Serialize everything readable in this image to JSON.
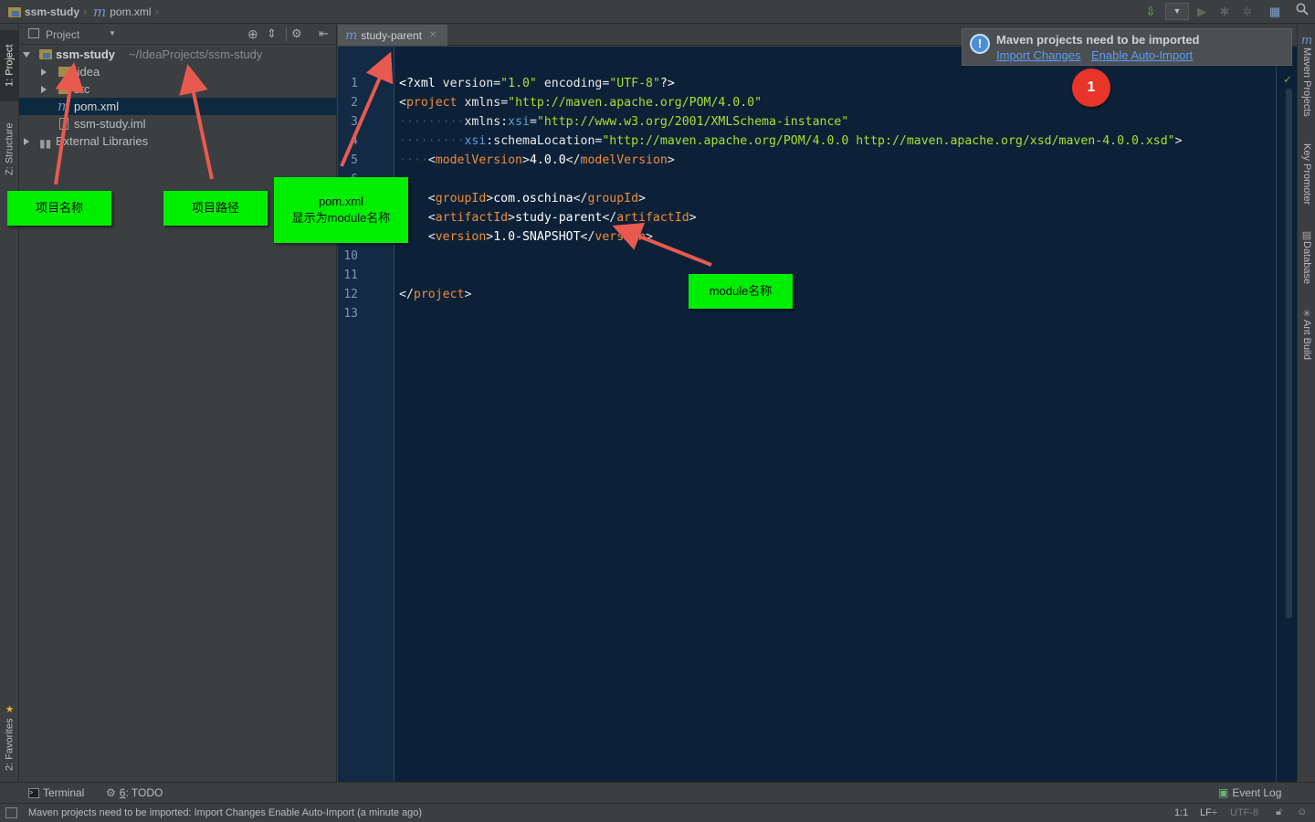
{
  "breadcrumb": {
    "project": "ssm-study",
    "file_icon": "m",
    "file": "pom.xml"
  },
  "left_strip": {
    "project_tab": "1: Project",
    "structure_tab": "Z: Structure",
    "favorites_tab": "2: Favorites"
  },
  "right_strip": {
    "maven_tab": "Maven Projects",
    "key_promoter_tab": "Key Promoter",
    "database_tab": "Database",
    "ant_tab": "Ant Build"
  },
  "project_panel": {
    "view_label": "Project",
    "tree": [
      {
        "name": "ssm-study",
        "path": "~/IdeaProjects/ssm-study"
      },
      {
        "name": ".idea"
      },
      {
        "name": "src"
      },
      {
        "name": "pom.xml"
      },
      {
        "name": "ssm-study.iml"
      },
      {
        "name": "External Libraries"
      }
    ]
  },
  "editor": {
    "tab_icon": "m",
    "tab_label": "study-parent",
    "line_numbers": [
      "1",
      "2",
      "3",
      "4",
      "5",
      "6",
      "7",
      "8",
      "9",
      "10",
      "11",
      "12",
      "13"
    ]
  },
  "notification": {
    "title": "Maven projects need to be imported",
    "link_import": "Import Changes",
    "link_auto": "Enable Auto-Import"
  },
  "annotations": {
    "project_name": "项目名称",
    "project_path": "项目路径",
    "pom_line1": "pom.xml",
    "pom_line2": "显示为module名称",
    "module_name": "module名称",
    "badge": "1"
  },
  "bottom_bar": {
    "terminal": "Terminal",
    "todo_num": "6",
    "todo": ": TODO",
    "event_log": "Event Log"
  },
  "status_bar": {
    "message": "Maven projects need to be imported: Import Changes Enable Auto-Import (a minute ago)",
    "position": "1:1",
    "line_sep": "LF÷",
    "encoding": "UTF-8"
  },
  "colors": {
    "editor_bg": "#0c2138",
    "tag": "#f08c38",
    "value": "#a6e22e",
    "annotation_green": "#00ee00",
    "annotation_arrow": "#e85a4f",
    "badge_red": "#e8352a"
  }
}
